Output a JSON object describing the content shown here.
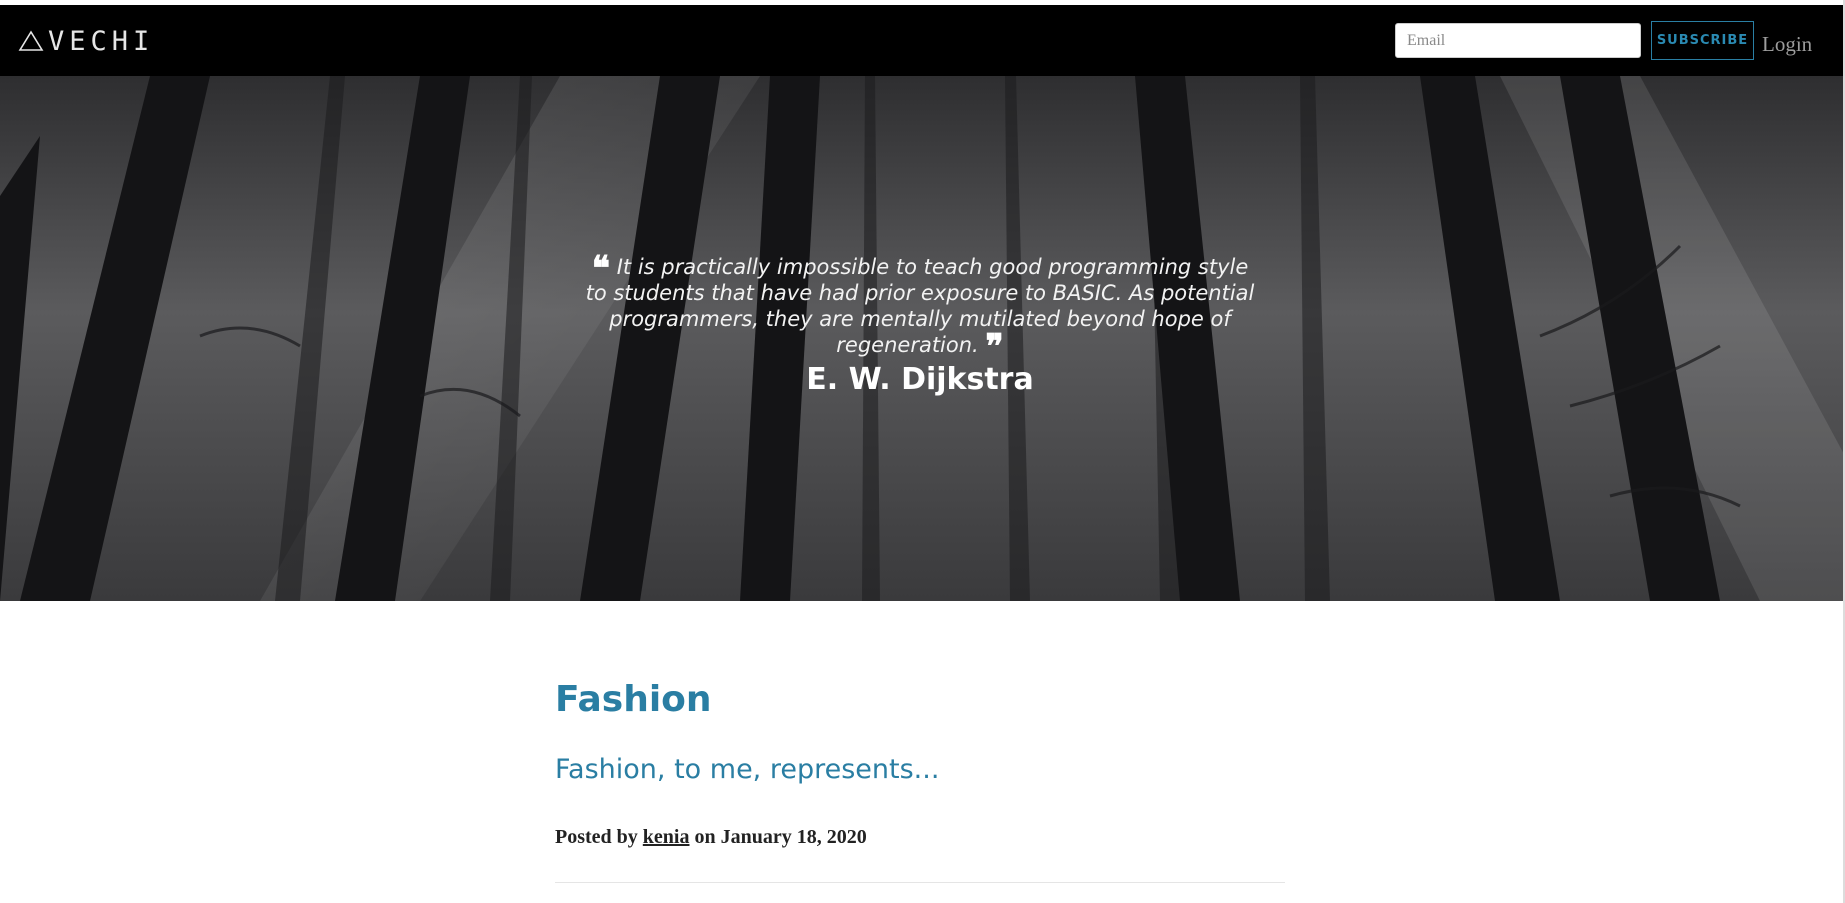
{
  "navbar": {
    "brand": "VECHI",
    "brand_icon": "triangle-icon",
    "email_placeholder": "Email",
    "subscribe_label": "SUBSCRIBE",
    "login_label": "Login"
  },
  "hero": {
    "quote": "It is practically impossible to teach good programming style to students that have had prior exposure to BASIC. As potential programmers, they are mentally mutilated beyond hope of regeneration.",
    "author": "E. W. Dijkstra",
    "open_quote_icon": "quote-open-icon",
    "close_quote_icon": "quote-close-icon"
  },
  "post": {
    "title": "Fashion",
    "subtitle": "Fashion, to me, represents...",
    "meta_prefix": "Posted by",
    "author": "kenia",
    "meta_on": "on",
    "date": "January 18, 2020"
  },
  "colors": {
    "accent": "#2a7ea3",
    "navbar_bg": "#000000",
    "subscribe_border": "#2a7fa4"
  }
}
